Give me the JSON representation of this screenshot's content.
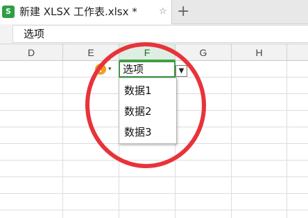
{
  "tab": {
    "icon_text": "S",
    "title": "新建 XLSX 工作表.xlsx *",
    "close_label": "☆",
    "new_tab_label": "+"
  },
  "formula_bar": {
    "value": "选项"
  },
  "columns": [
    "D",
    "E",
    "F",
    "G",
    "H"
  ],
  "active_column": "F",
  "active_cell": {
    "value": "选项",
    "dropdown_arrow": "▼"
  },
  "warning": {
    "icon_text": "!",
    "caret": "▾"
  },
  "dropdown_options": [
    "数据1",
    "数据2",
    "数据3"
  ],
  "colors": {
    "accent_green": "#3f9a44",
    "warning_orange": "#f0a01e",
    "annotation_red": "#e8333a"
  }
}
